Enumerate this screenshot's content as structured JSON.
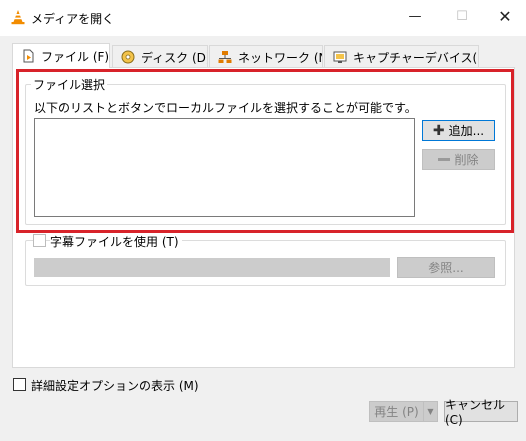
{
  "window": {
    "title": "メディアを開く",
    "minimize_glyph": "—",
    "maximize_glyph": "☐",
    "close_glyph": "✕"
  },
  "tabs": [
    {
      "label": "ファイル (F)",
      "icon": "file-icon",
      "active": true
    },
    {
      "label": "ディスク (D)",
      "icon": "disc-icon",
      "active": false
    },
    {
      "label": "ネットワーク (N)",
      "icon": "network-icon",
      "active": false
    },
    {
      "label": "キャプチャーデバイス(D)...",
      "icon": "capture-icon",
      "active": false
    }
  ],
  "file_selection": {
    "group_title": "ファイル選択",
    "hint": "以下のリストとボタンでローカルファイルを選択することが可能です。",
    "add_label": "追加...",
    "remove_label": "削除"
  },
  "subtitle": {
    "checkbox_label": "字幕ファイルを使用 (T)",
    "browse_label": "参照..."
  },
  "advanced": {
    "checkbox_label": "詳細設定オプションの表示 (M)"
  },
  "footer": {
    "play_label": "再生 (P)",
    "cancel_label": "キャンセル (C)"
  },
  "colors": {
    "highlight": "#d8232a",
    "accent": "#0078d7",
    "vlc_orange": "#f28c00"
  }
}
